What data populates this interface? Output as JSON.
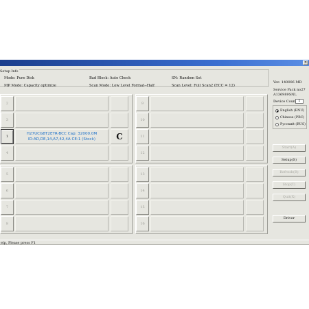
{
  "window": {
    "title": ""
  },
  "setup_info": {
    "label": "Setup Info",
    "mode": "Mode: Pure Disk",
    "mp_mode": "MP Mode: Capacity optimize",
    "bad_block": "Bad Block: Auto Check",
    "scan_mode": "Scan Mode: Low Level Format--Half",
    "sn": "SN: Random Set",
    "scan_level": "Scan Level: Full Scan2 (ECC = 12)"
  },
  "version_panel": {
    "ver": "Ver: 140006 MD",
    "service_pack": "Service Pack no27",
    "build": "A136989SNL",
    "device_count_label": "Device Count:",
    "device_count": "1"
  },
  "languages": [
    {
      "label": "English (ENU)",
      "selected": true
    },
    {
      "label": "Chinese (PRC)",
      "selected": false
    },
    {
      "label": "Pусский (RUS)",
      "selected": false
    }
  ],
  "buttons": {
    "start": "Start(A)",
    "setup": "Setup(S)",
    "refresh": "Refresh(R)",
    "stop": "Stop(T)",
    "quit": "Quit(X)",
    "driver": "Driver"
  },
  "slots": [
    {
      "num": "1",
      "text_line1": "H27UCG8T2ETR-BCC Cap: 32000.0M",
      "text_line2": "ID:AD,DE,14,A7,42,4A CE:1 (Stock)",
      "status": "C"
    },
    {
      "num": "2",
      "text_line1": "",
      "text_line2": "",
      "status": ""
    },
    {
      "num": "3",
      "text_line1": "",
      "text_line2": "",
      "status": ""
    },
    {
      "num": "4",
      "text_line1": "",
      "text_line2": "",
      "status": ""
    },
    {
      "num": "5",
      "text_line1": "",
      "text_line2": "",
      "status": ""
    },
    {
      "num": "6",
      "text_line1": "",
      "text_line2": "",
      "status": ""
    },
    {
      "num": "7",
      "text_line1": "",
      "text_line2": "",
      "status": ""
    },
    {
      "num": "8",
      "text_line1": "",
      "text_line2": "",
      "status": ""
    },
    {
      "num": "9",
      "text_line1": "",
      "text_line2": "",
      "status": ""
    },
    {
      "num": "10",
      "text_line1": "",
      "text_line2": "",
      "status": ""
    },
    {
      "num": "11",
      "text_line1": "",
      "text_line2": "",
      "status": ""
    },
    {
      "num": "12",
      "text_line1": "",
      "text_line2": "",
      "status": ""
    },
    {
      "num": "13",
      "text_line1": "",
      "text_line2": "",
      "status": ""
    },
    {
      "num": "14",
      "text_line1": "",
      "text_line2": "",
      "status": ""
    },
    {
      "num": "15",
      "text_line1": "",
      "text_line2": "",
      "status": ""
    },
    {
      "num": "16",
      "text_line1": "",
      "text_line2": "",
      "status": ""
    }
  ],
  "statusbar": {
    "text": "elp, Please press F1"
  },
  "colors": {
    "slot_text": "#1a6fc8",
    "window_bg": "#e6e6e0",
    "titlebar": "#1a3d8c"
  }
}
